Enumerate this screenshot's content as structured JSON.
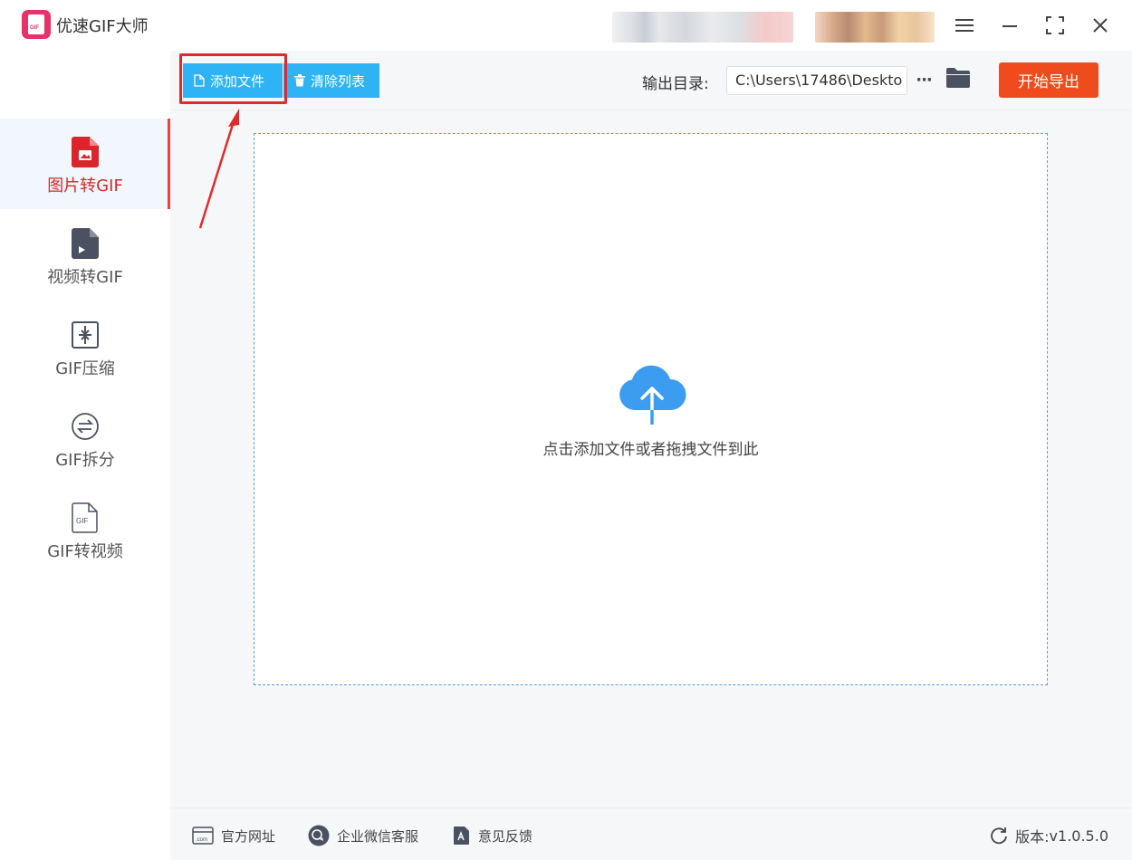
{
  "app": {
    "title": "优速GIF大师",
    "logo_text": "GIF",
    "accent_color": "#e8306a"
  },
  "sidebar": {
    "items": [
      {
        "label": "图片转GIF",
        "icon": "image-file-icon",
        "active": true
      },
      {
        "label": "视频转GIF",
        "icon": "video-file-icon",
        "active": false
      },
      {
        "label": "GIF压缩",
        "icon": "compress-icon",
        "active": false
      },
      {
        "label": "GIF拆分",
        "icon": "split-icon",
        "active": false
      },
      {
        "label": "GIF转视频",
        "icon": "gif-file-icon",
        "active": false
      }
    ]
  },
  "toolbar": {
    "add_file_label": "添加文件",
    "clear_list_label": "清除列表",
    "output_dir_label": "输出目录:",
    "output_dir_value": "C:\\Users\\17486\\Deskto",
    "more_label": "···",
    "export_label": "开始导出"
  },
  "dropzone": {
    "hint": "点击添加文件或者拖拽文件到此"
  },
  "footer": {
    "website_label": "官方网址",
    "wechat_label": "企业微信客服",
    "feedback_label": "意见反馈",
    "version_label": "版本:",
    "version_value": "v1.0.5.0"
  },
  "colors": {
    "primary_blue": "#2eb4f5",
    "export_red": "#f04b1c",
    "annotation_red": "#e02b2b"
  }
}
